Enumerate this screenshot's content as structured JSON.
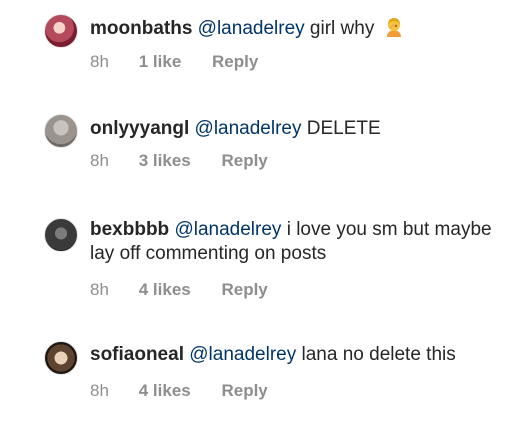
{
  "comments": [
    {
      "username": "moonbaths",
      "mention": "@lanadelrey",
      "text": " girl why",
      "emoji": "woman-facepalming-emoji",
      "time": "8h",
      "likes": "1 like",
      "reply": "Reply"
    },
    {
      "username": "onlyyyangl",
      "mention": "@lanadelrey",
      "text": " DELETE",
      "time": "8h",
      "likes": "3 likes",
      "reply": "Reply"
    },
    {
      "username": "bexbbbb",
      "mention": "@lanadelrey",
      "text": " i love you sm but maybe lay off commenting on posts",
      "time": "8h",
      "likes": "4 likes",
      "reply": "Reply"
    },
    {
      "username": "sofiaoneal",
      "mention": "@lanadelrey",
      "text": " lana no delete this",
      "time": "8h",
      "likes": "4 likes",
      "reply": "Reply"
    }
  ]
}
